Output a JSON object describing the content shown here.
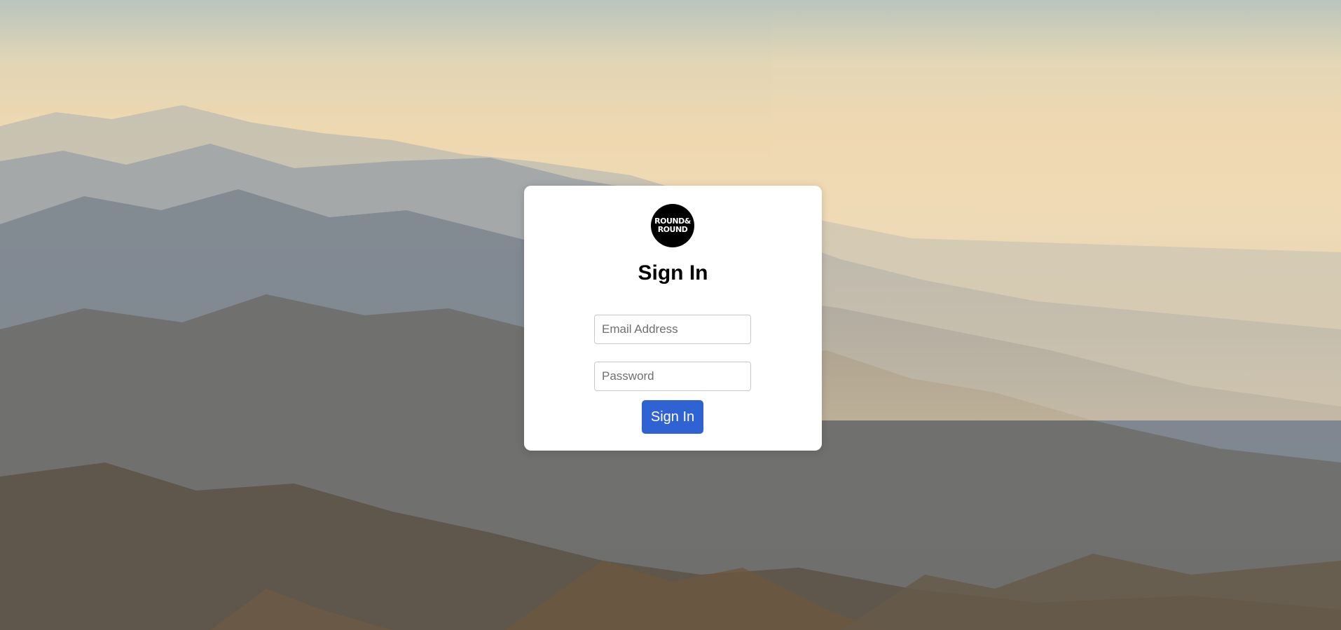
{
  "background": {
    "description_icon": "mountain-range-photo"
  },
  "login": {
    "logo_line1": "ROUND&",
    "logo_line2": "ROUND",
    "title": "Sign In",
    "email_placeholder": "Email Address",
    "email_value": "",
    "password_placeholder": "Password",
    "password_value": "",
    "submit_label": "Sign In"
  },
  "colors": {
    "button_bg": "#2f63d3",
    "card_bg": "#ffffff",
    "logo_bg": "#000000"
  }
}
